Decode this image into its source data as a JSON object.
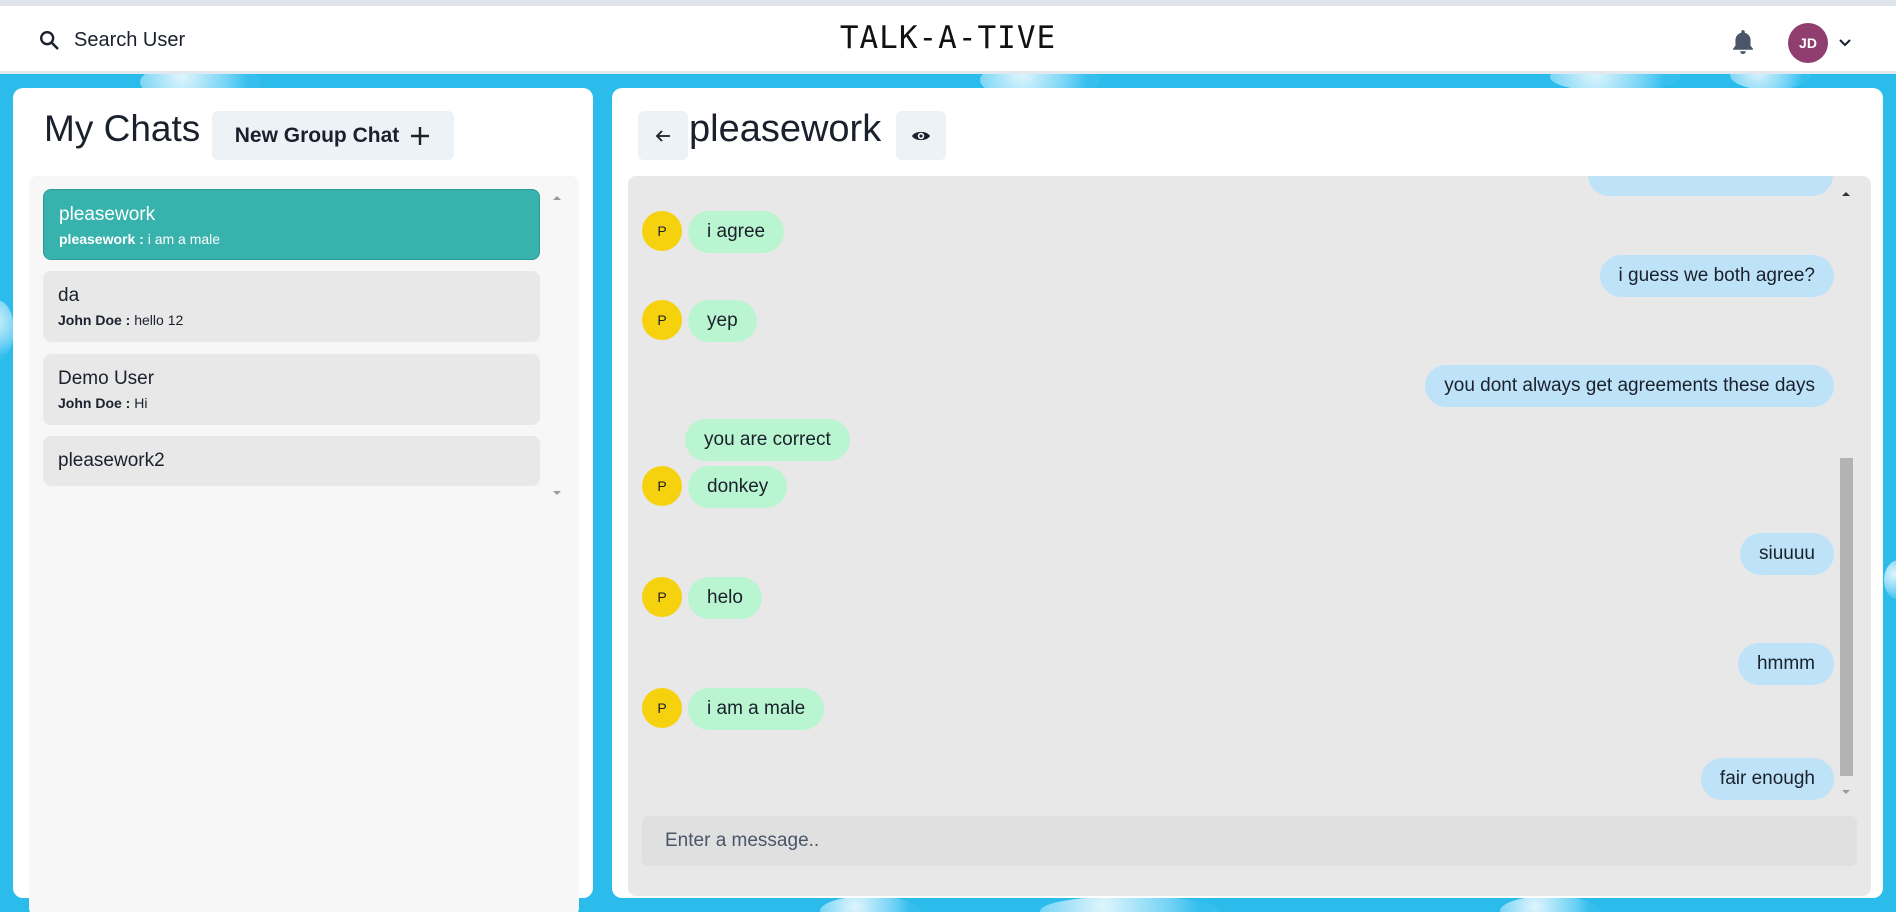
{
  "header": {
    "search_label": "Search User",
    "app_title": "TALK-A-TIVE",
    "user_initials": "JD",
    "user_avatar_color": "#8f3e6f"
  },
  "sidebar": {
    "title": "My Chats",
    "new_group_label": "New Group Chat",
    "chats": [
      {
        "name": "pleasework",
        "sender": "pleasework :",
        "message": "i am a male",
        "active": true
      },
      {
        "name": "da",
        "sender": "John Doe :",
        "message": "hello 12",
        "active": false
      },
      {
        "name": "Demo User",
        "sender": "John Doe :",
        "message": "Hi",
        "active": false
      },
      {
        "name": "pleasework2",
        "sender": "",
        "message": "",
        "active": false
      }
    ]
  },
  "chat": {
    "title": "pleasework",
    "sender_avatar_letter": "P",
    "messages": [
      {
        "text": "i agree",
        "direction": "in"
      },
      {
        "text": "i guess we both agree?",
        "direction": "out"
      },
      {
        "text": "yep",
        "direction": "in"
      },
      {
        "text": "you dont always get agreements these days",
        "direction": "out"
      },
      {
        "text": "you are correct",
        "direction": "in"
      },
      {
        "text": "donkey",
        "direction": "in"
      },
      {
        "text": "siuuuu",
        "direction": "out"
      },
      {
        "text": "helo",
        "direction": "in"
      },
      {
        "text": "hmmm",
        "direction": "out"
      },
      {
        "text": "i am a male",
        "direction": "in"
      },
      {
        "text": "fair enough",
        "direction": "out"
      }
    ],
    "input_placeholder": "Enter a message.."
  },
  "colors": {
    "background": "#2bbcec",
    "active_chat": "#38b2ac",
    "incoming_bubble": "#b9f5d0",
    "outgoing_bubble": "#bee3f8",
    "sender_avatar": "#f6d20e"
  }
}
